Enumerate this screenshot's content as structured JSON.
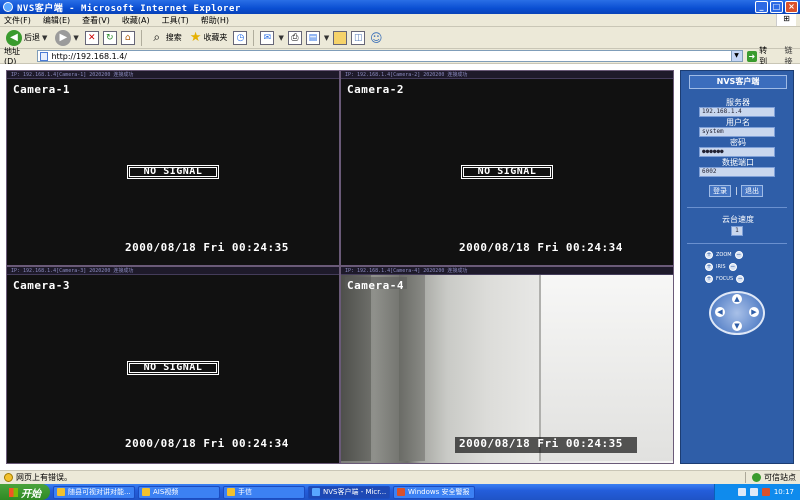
{
  "window": {
    "title": "NVS客户端 - Microsoft Internet Explorer",
    "controls": [
      "_",
      "□",
      "×"
    ]
  },
  "menu": {
    "items": [
      "文件(F)",
      "编辑(E)",
      "查看(V)",
      "收藏(A)",
      "工具(T)",
      "帮助(H)"
    ]
  },
  "toolbar": {
    "back_label": "后退",
    "search_label": "搜索",
    "favorites_label": "收藏夹"
  },
  "address": {
    "label": "地址(D)",
    "url": "http://192.168.1.4/",
    "go_label": "转到",
    "links_label": "链接"
  },
  "cameras": [
    {
      "header": "IP: 192.168.1.4[Camera-1] 2020200 连接成功",
      "label": "Camera-1",
      "no_signal": "NO SIGNAL",
      "timestamp": "2000/08/18 Fri 00:24:35"
    },
    {
      "header": "IP: 192.168.1.4[Camera-2] 2020200 连接成功",
      "label": "Camera-2",
      "no_signal": "NO SIGNAL",
      "timestamp": "2000/08/18 Fri 00:24:34"
    },
    {
      "header": "IP: 192.168.1.4[Camera-3] 2020200 连接成功",
      "label": "Camera-3",
      "no_signal": "NO SIGNAL",
      "timestamp": "2000/08/18 Fri 00:24:34"
    },
    {
      "header": "IP: 192.168.1.4[Camera-4] 2020200 连接成功",
      "label": "Camera-4",
      "timestamp": "2000/08/18 Fri 00:24:35"
    }
  ],
  "panel": {
    "title": "NVS客户端",
    "server_label": "服务器",
    "server_value": "192.168.1.4",
    "user_label": "用户名",
    "user_value": "system",
    "password_label": "密码",
    "password_value": "●●●●●●",
    "port_label": "数据端口",
    "port_value": "6002",
    "login_label": "登录",
    "logout_label": "退出",
    "separator": "|",
    "speed_label": "云台速度",
    "speed_value": "1",
    "zoom_label": "ZOOM",
    "iris_label": "IRIS",
    "focus_label": "FOCUS"
  },
  "status": {
    "message": "网页上有错误。",
    "zone": "可信站点"
  },
  "taskbar": {
    "start_label": "开始",
    "tasks": [
      "随县可视对讲对能...",
      "AIS视频",
      "手信",
      "NVS客户端 - Micr...",
      "Windows 安全警报"
    ],
    "clock": "10:17"
  }
}
